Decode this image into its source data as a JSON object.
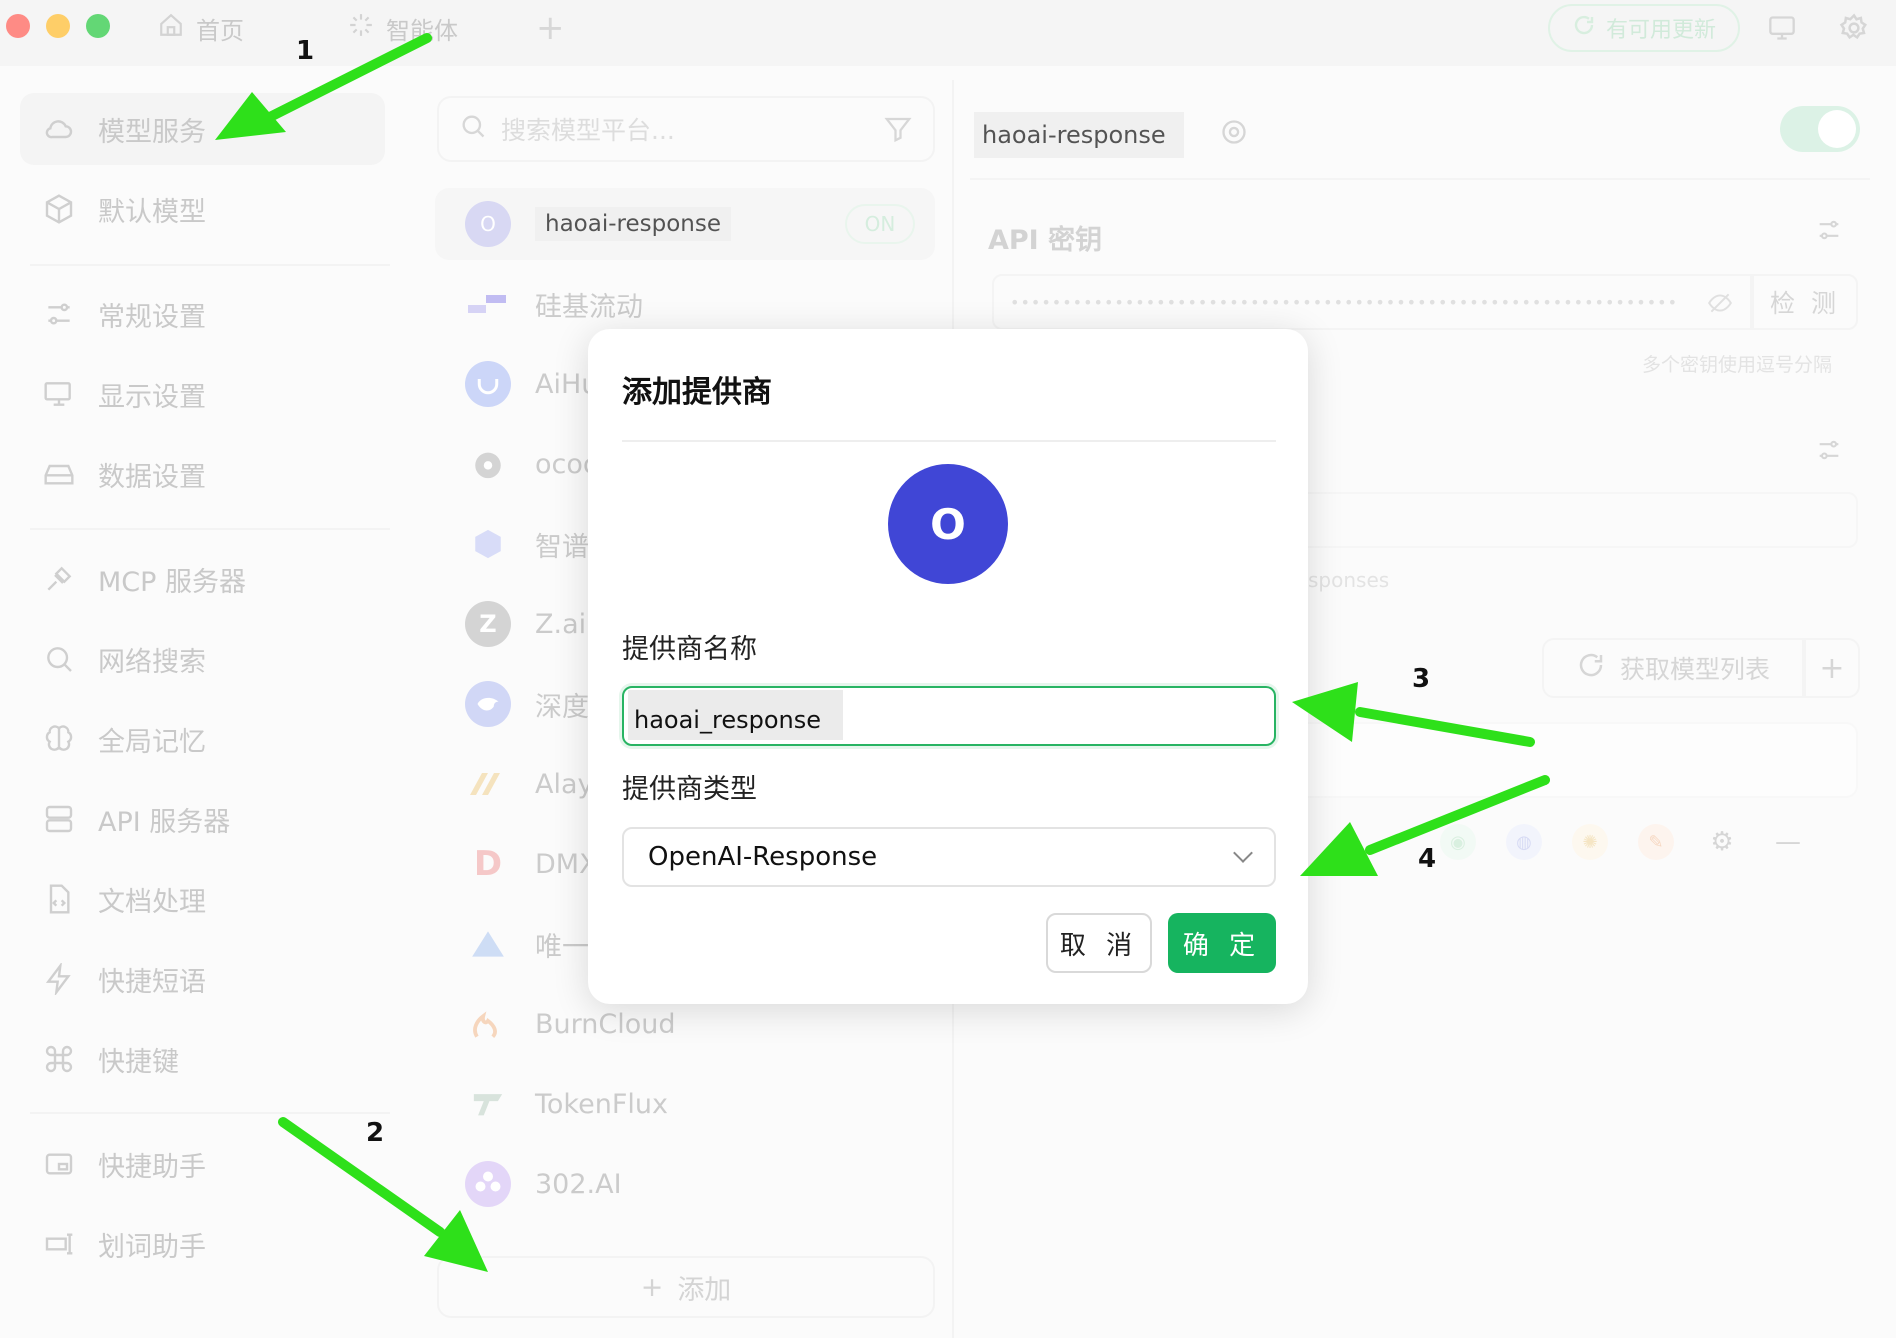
{
  "titlebar": {
    "tabs": [
      {
        "label": "首页",
        "icon": "home-icon"
      },
      {
        "label": "智能体",
        "icon": "sparkle-icon"
      }
    ],
    "new_tab_label": "+",
    "update_label": "有可用更新"
  },
  "nav": {
    "items": [
      {
        "label": "模型服务",
        "icon": "cloud-icon",
        "active": true
      },
      {
        "label": "默认模型",
        "icon": "cube-icon"
      },
      {
        "label": "常规设置",
        "icon": "sliders-icon"
      },
      {
        "label": "显示设置",
        "icon": "monitor-icon"
      },
      {
        "label": "数据设置",
        "icon": "drive-icon"
      },
      {
        "label": "MCP 服务器",
        "icon": "plug-icon"
      },
      {
        "label": "网络搜索",
        "icon": "search-icon"
      },
      {
        "label": "全局记忆",
        "icon": "brain-icon"
      },
      {
        "label": "API 服务器",
        "icon": "server-icon"
      },
      {
        "label": "文档处理",
        "icon": "document-icon"
      },
      {
        "label": "快捷短语",
        "icon": "bolt-icon"
      },
      {
        "label": "快捷键",
        "icon": "command-icon"
      },
      {
        "label": "快捷助手",
        "icon": "window-icon"
      },
      {
        "label": "划词助手",
        "icon": "text-select-icon"
      }
    ]
  },
  "providers": {
    "search_placeholder": "搜索模型平台...",
    "items": [
      {
        "name": "haoai-response",
        "logo": "O",
        "status": "ON",
        "active": true
      },
      {
        "name": "硅基流动"
      },
      {
        "name": "AiHu"
      },
      {
        "name": "ococ"
      },
      {
        "name": "智谱"
      },
      {
        "name": "Z.ai"
      },
      {
        "name": "深度"
      },
      {
        "name": "Alay"
      },
      {
        "name": "DMX"
      },
      {
        "name": "唯一"
      },
      {
        "name": "BurnCloud"
      },
      {
        "name": "TokenFlux"
      },
      {
        "name": "302.AI"
      }
    ],
    "add_label": "添加"
  },
  "right_panel": {
    "provider_name": "haoai-response",
    "api_key_label": "API 密钥",
    "api_key_mask": "••••••••••••••••••••••••••••••••••••••••••••••••••••••••••••••••",
    "check_label": "检 测",
    "key_hint": "多个密钥使用逗号分隔",
    "api_url_hint": "sponses",
    "fetch_models_label": "获取模型列表"
  },
  "modal": {
    "title": "添加提供商",
    "avatar_letter": "O",
    "name_label": "提供商名称",
    "name_value": "haoai_response",
    "type_label": "提供商类型",
    "type_value": "OpenAI-Response",
    "cancel_label": "取 消",
    "ok_label": "确 定"
  },
  "annotations": [
    "1",
    "2",
    "3",
    "4"
  ],
  "colors": {
    "accent": "#16b45f",
    "avatar": "#4046d6",
    "arrow": "#2ee01a"
  }
}
